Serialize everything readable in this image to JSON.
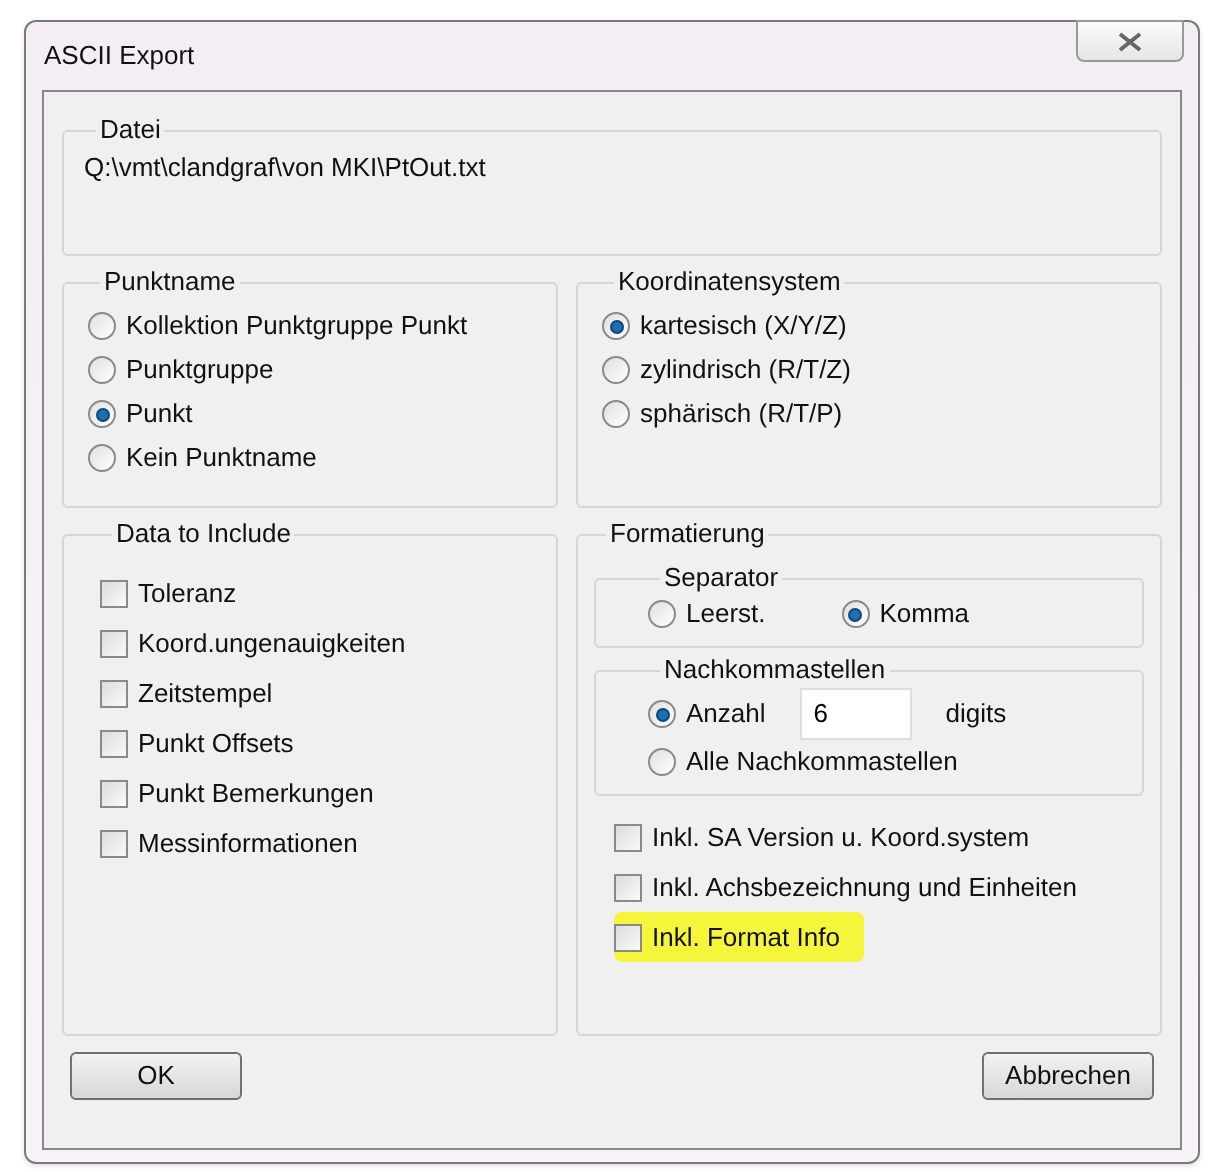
{
  "window": {
    "title": "ASCII Export"
  },
  "file": {
    "label": "Datei",
    "path": "Q:\\vmt\\clandgraf\\von MKI\\PtOut.txt"
  },
  "point_name": {
    "label": "Punktname",
    "options": [
      {
        "label": "Kollektion Punktgruppe Punkt",
        "selected": false
      },
      {
        "label": "Punktgruppe",
        "selected": false
      },
      {
        "label": "Punkt",
        "selected": true
      },
      {
        "label": "Kein Punktname",
        "selected": false
      }
    ]
  },
  "coordinate_system": {
    "label": "Koordinatensystem",
    "options": [
      {
        "label": "kartesisch (X/Y/Z)",
        "selected": true
      },
      {
        "label": "zylindrisch (R/T/Z)",
        "selected": false
      },
      {
        "label": "sphärisch (R/T/P)",
        "selected": false
      }
    ]
  },
  "data_to_include": {
    "label": "Data to Include",
    "items": [
      {
        "label": "Toleranz",
        "checked": false
      },
      {
        "label": "Koord.ungenauigkeiten",
        "checked": false
      },
      {
        "label": "Zeitstempel",
        "checked": false
      },
      {
        "label": "Punkt Offsets",
        "checked": false
      },
      {
        "label": "Punkt Bemerkungen",
        "checked": false
      },
      {
        "label": "Messinformationen",
        "checked": false
      }
    ]
  },
  "formatting": {
    "label": "Formatierung",
    "separator": {
      "label": "Separator",
      "options": [
        {
          "label": "Leerst.",
          "selected": false
        },
        {
          "label": "Komma",
          "selected": true
        }
      ]
    },
    "decimals": {
      "label": "Nachkommastellen",
      "count_option": {
        "label": "Anzahl",
        "selected": true
      },
      "count_value": "6",
      "unit": "digits",
      "all_option": {
        "label": "Alle Nachkommastellen",
        "selected": false
      }
    },
    "options": [
      {
        "label": "Inkl. SA Version u. Koord.system",
        "checked": false,
        "highlighted": false
      },
      {
        "label": "Inkl. Achsbezeichnung und Einheiten",
        "checked": false,
        "highlighted": false
      },
      {
        "label": "Inkl. Format Info",
        "checked": false,
        "highlighted": true
      }
    ]
  },
  "buttons": [
    {
      "label": "OK"
    },
    {
      "label": "Abbrechen"
    }
  ]
}
